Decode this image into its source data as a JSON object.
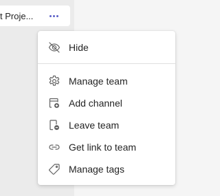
{
  "team_list": {
    "team_name": "t Proje...",
    "more_icon": "more-horizontal-icon"
  },
  "menu": {
    "items": [
      {
        "label": "Hide",
        "icon": "eye-off-icon"
      },
      {
        "label": "Manage team",
        "icon": "gear-icon"
      },
      {
        "label": "Add channel",
        "icon": "add-channel-icon"
      },
      {
        "label": "Leave team",
        "icon": "leave-team-icon"
      },
      {
        "label": "Get link to team",
        "icon": "link-icon"
      },
      {
        "label": "Manage tags",
        "icon": "tag-icon"
      }
    ]
  },
  "colors": {
    "accent": "#5b5fc7",
    "text": "#242424",
    "icon": "#616161"
  }
}
